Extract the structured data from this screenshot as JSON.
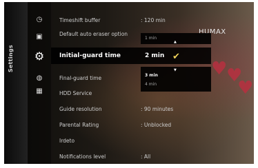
{
  "sidebar": {
    "label": "Settings"
  },
  "logo": {
    "text": "HUMAX"
  },
  "rows": [
    {
      "label": "Timeshift buffer",
      "value": ": 120 min"
    },
    {
      "label": "Default auto eraser option",
      "value": ""
    },
    {
      "label": "Initial-guard time",
      "value": "2 min"
    },
    {
      "label": "Final-guard time",
      "value": ""
    },
    {
      "label": "HDD Service",
      "value": ""
    },
    {
      "label": "Guide resolution",
      "value": ": 90 minutes"
    },
    {
      "label": "Parental Rating",
      "value": ": Unblocked"
    },
    {
      "label": "Irdeto",
      "value": ""
    },
    {
      "label": "Notifications level",
      "value": ": All"
    }
  ],
  "popup_above": {
    "option": "1 min"
  },
  "popup_below": {
    "option1": "3 min",
    "option2": "4 min"
  },
  "colors": {
    "accent": "#f0d25a",
    "heart": "#b83040"
  }
}
